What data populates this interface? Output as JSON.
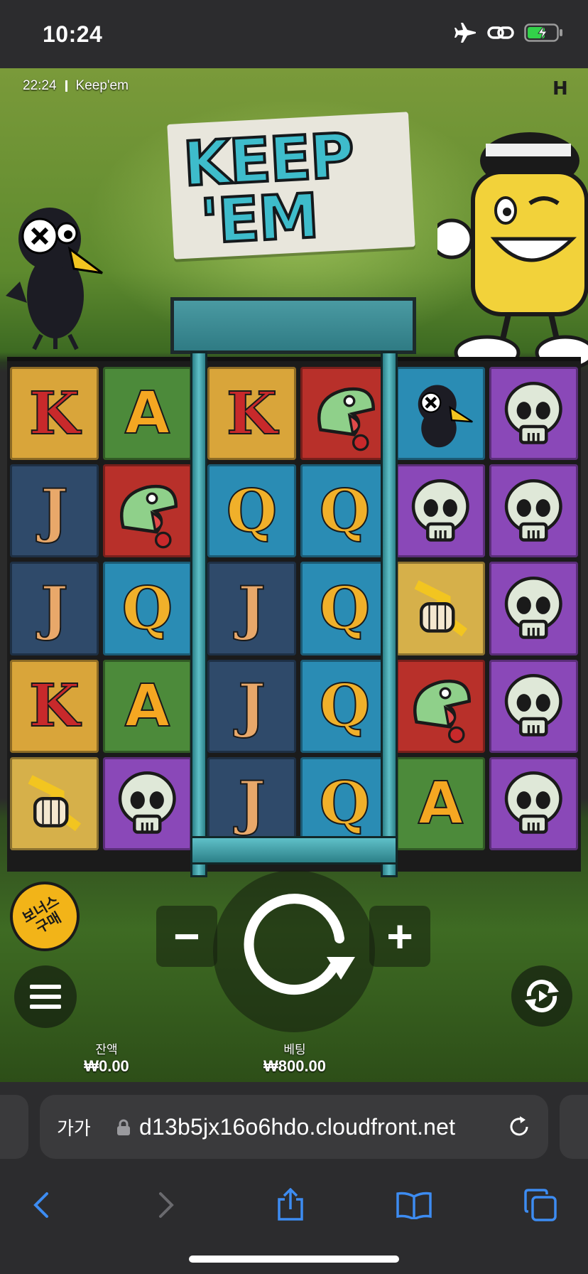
{
  "status_bar": {
    "time": "10:24"
  },
  "game": {
    "header_time": "22:24",
    "header_title": "Keep'em",
    "logo_line1": "KEEP",
    "logo_line2": "'EM",
    "provider_mark": "H",
    "reels": [
      [
        [
          "K",
          "A"
        ],
        [
          "J",
          "snake"
        ],
        [
          "J",
          "Q"
        ],
        [
          "K",
          "A"
        ],
        [
          "fist",
          "skull"
        ]
      ],
      [
        [
          "K",
          "snake"
        ],
        [
          "Q",
          "Q"
        ],
        [
          "J",
          "Q"
        ],
        [
          "J",
          "Q"
        ],
        [
          "J",
          "Q"
        ]
      ],
      [
        [
          "crow",
          "skull"
        ],
        [
          "skull",
          "skull"
        ],
        [
          "fist",
          "skull"
        ],
        [
          "snake",
          "skull"
        ],
        [
          "A",
          "skull"
        ]
      ]
    ],
    "controls": {
      "minus_label": "−",
      "plus_label": "+",
      "bonus_label": "보너스 구매",
      "balance_label": "잔액",
      "balance_value": "₩0.00",
      "bet_label": "베팅",
      "bet_value": "₩800.00"
    }
  },
  "browser": {
    "aa_label": "가가",
    "url": "d13b5jx16o6hdo.cloudfront.net"
  },
  "colors": {
    "accent_teal": "#3ebccb",
    "browser_blue": "#3d8cf2"
  }
}
